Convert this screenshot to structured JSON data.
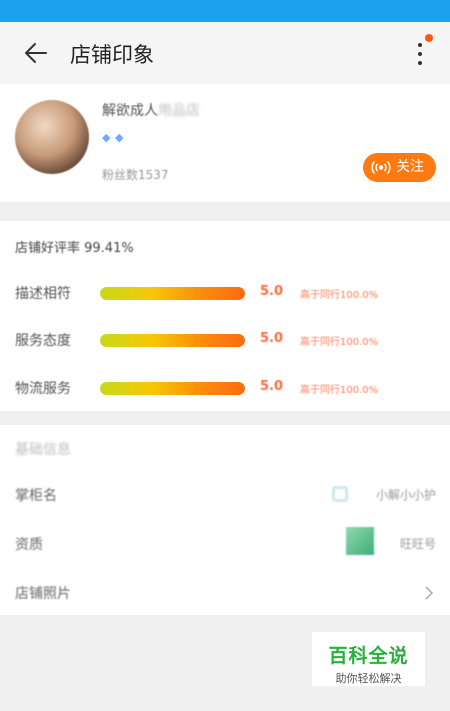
{
  "appbar": {
    "title": "店铺印象"
  },
  "shop": {
    "name": "解欲成人",
    "name_faded": "用品店",
    "diamond_count": 2,
    "fans": "粉丝数1537",
    "follow_label": "关注"
  },
  "ratings": {
    "title": "店铺好评率 99.41%",
    "items": [
      {
        "label": "描述相符",
        "score": "5.0",
        "compare": "高于同行100.0%",
        "fill_percent": 100
      },
      {
        "label": "服务态度",
        "score": "5.0",
        "compare": "高于同行100.0%",
        "fill_percent": 100
      },
      {
        "label": "物流服务",
        "score": "5.0",
        "compare": "高于同行100.0%",
        "fill_percent": 100
      }
    ]
  },
  "info": {
    "heading": "基础信息",
    "rows": [
      {
        "label": "掌柜名",
        "value": "小解小小护"
      },
      {
        "label": "资质",
        "value": "旺旺号"
      },
      {
        "label": "店铺照片",
        "value": ""
      }
    ]
  },
  "watermark": {
    "title": "百科全说",
    "subtitle": "助你轻松解决"
  },
  "colors": {
    "statusbar": "#1aa2f0",
    "accent": "#ff7a10",
    "score": "#ff6a3a",
    "watermark": "#26b13a"
  }
}
